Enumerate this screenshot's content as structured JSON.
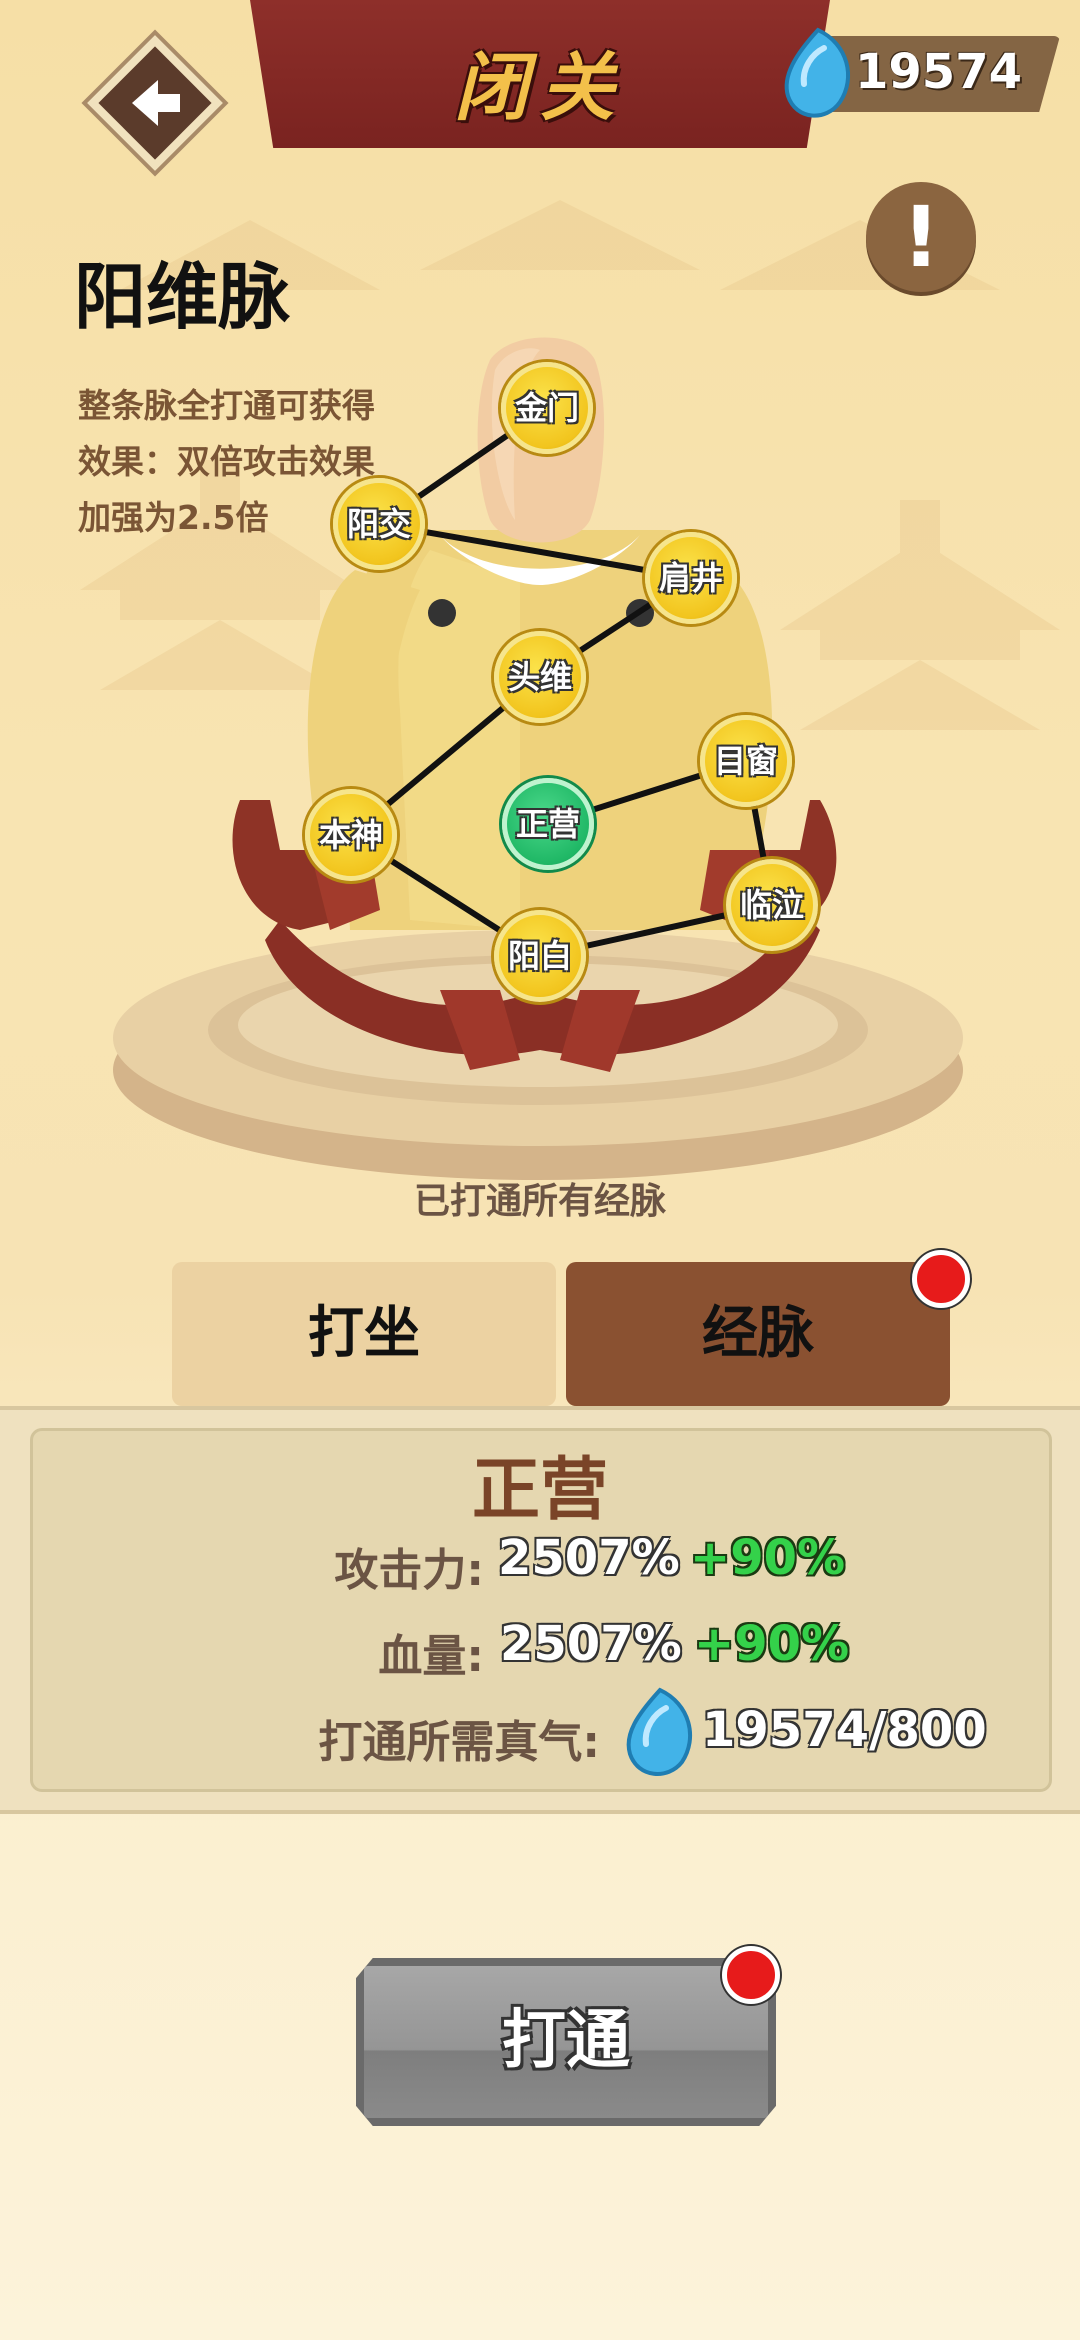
{
  "header": {
    "title": "闭关",
    "currency_value": "19574",
    "back_icon": "back-arrow-icon",
    "info_label": "!"
  },
  "meridian": {
    "name": "阳维脉",
    "description_lines": [
      "整条脉全打通可获得",
      "效果：双倍攻击效果",
      "加强为2.5倍"
    ],
    "points": [
      "金门",
      "阳交",
      "肩井",
      "头维",
      "目窗",
      "正营",
      "本神",
      "临泣",
      "阳白"
    ],
    "status": "已打通所有经脉"
  },
  "tabs": {
    "sit": "打坐",
    "meridian": "经脉"
  },
  "detail": {
    "title": "正营",
    "attack_label": "攻击力:",
    "attack_value": "2507%",
    "attack_bonus": "+90%",
    "hp_label": "血量:",
    "hp_value": "2507%",
    "hp_bonus": "+90%",
    "qi_label": "打通所需真气:",
    "qi_value": "19574/800"
  },
  "action": {
    "label": "打通"
  },
  "colors": {
    "banner": "#8e2f2a",
    "point_gold": "#f2c51e",
    "point_active": "#20b866",
    "tab_active": "#8a5131",
    "bonus_green": "#34d14a",
    "notify_red": "#e71b1b"
  }
}
